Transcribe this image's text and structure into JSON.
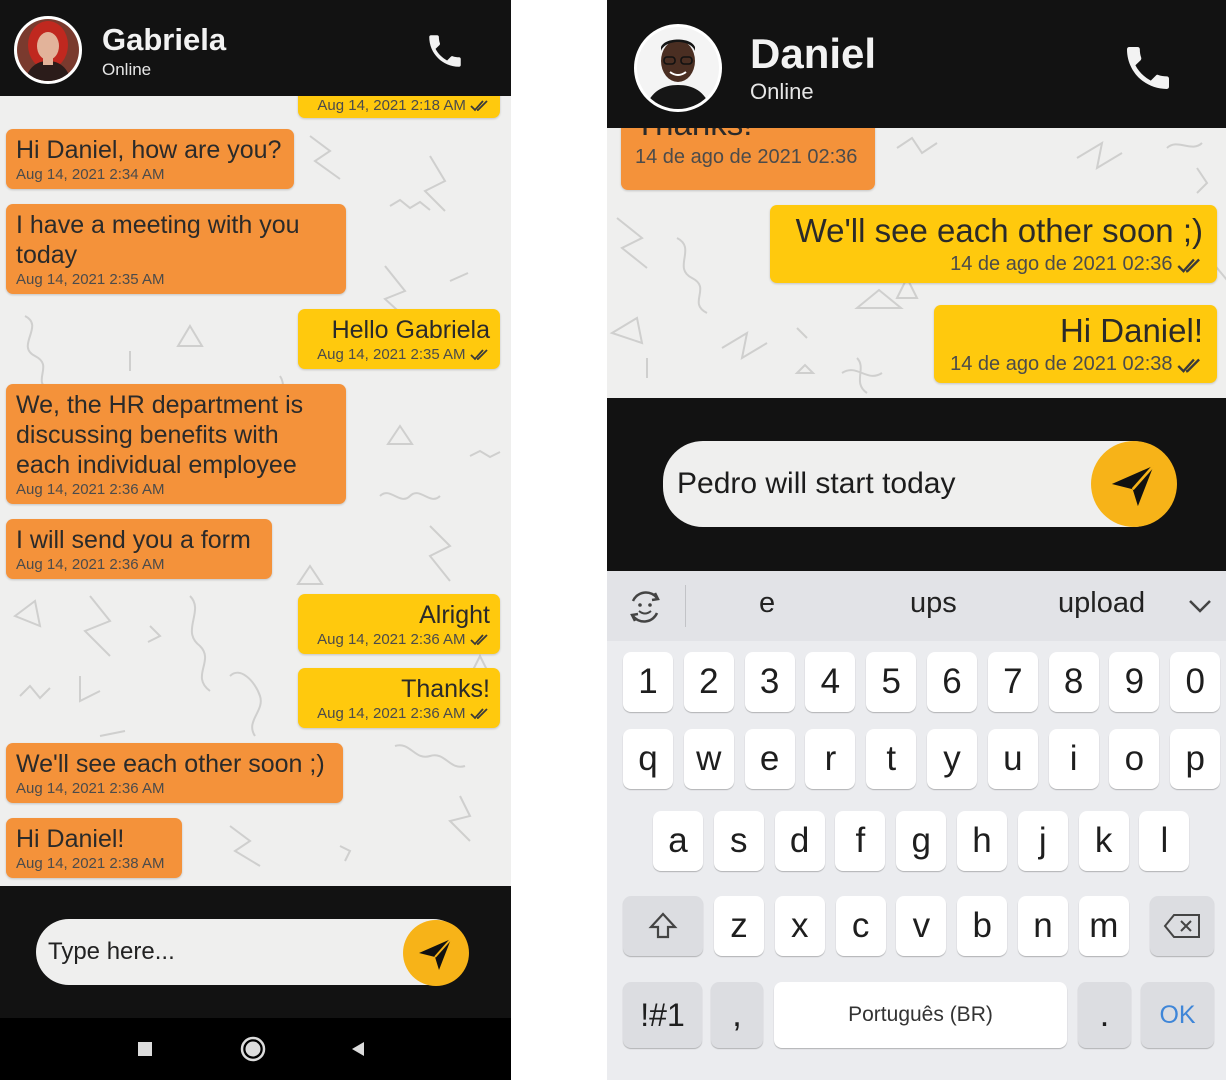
{
  "left_screen": {
    "contact": {
      "name": "Gabriela",
      "status": "Online"
    },
    "partial_top_time": "Aug 14, 2021 2:18 AM",
    "messages": [
      {
        "direction": "in",
        "text": "Hi Daniel, how are you?",
        "time": "Aug 14, 2021 2:34 AM"
      },
      {
        "direction": "in",
        "text": "I have a meeting with you\ntoday",
        "time": "Aug 14, 2021 2:35 AM"
      },
      {
        "direction": "out",
        "text": "Hello Gabriela",
        "time": "Aug 14, 2021 2:35 AM"
      },
      {
        "direction": "in",
        "text": "We, the HR department is\ndiscussing benefits with\neach individual  employee",
        "time": "Aug 14, 2021 2:36 AM"
      },
      {
        "direction": "in",
        "text": "I will send you a form",
        "time": "Aug 14, 2021 2:36 AM"
      },
      {
        "direction": "out",
        "text": "Alright",
        "time": "Aug 14, 2021 2:36 AM"
      },
      {
        "direction": "out",
        "text": "Thanks!",
        "time": "Aug 14, 2021 2:36 AM"
      },
      {
        "direction": "in",
        "text": "We'll see each other soon ;)",
        "time": "Aug 14, 2021 2:36 AM"
      },
      {
        "direction": "in",
        "text": "Hi Daniel!",
        "time": "Aug 14, 2021 2:38 AM"
      }
    ],
    "input": {
      "value": "",
      "placeholder": "Type here..."
    }
  },
  "right_screen": {
    "contact": {
      "name": "Daniel",
      "status": "Online"
    },
    "messages": [
      {
        "direction": "in",
        "text": "Thanks!",
        "time": "14 de ago de 2021 02:36"
      },
      {
        "direction": "out",
        "text": "We'll see each other soon ;)",
        "time": "14 de ago de 2021 02:36"
      },
      {
        "direction": "out",
        "text": "Hi Daniel!",
        "time": "14 de ago de 2021 02:38"
      }
    ],
    "input": {
      "value": "Pedro will start today",
      "placeholder": ""
    },
    "keyboard": {
      "suggestions": [
        "e",
        "ups",
        "upload"
      ],
      "row_numbers": [
        "1",
        "2",
        "3",
        "4",
        "5",
        "6",
        "7",
        "8",
        "9",
        "0"
      ],
      "row_1": [
        "q",
        "w",
        "e",
        "r",
        "t",
        "y",
        "u",
        "i",
        "o",
        "p"
      ],
      "row_2": [
        "a",
        "s",
        "d",
        "f",
        "g",
        "h",
        "j",
        "k",
        "l"
      ],
      "row_3": [
        "z",
        "x",
        "c",
        "v",
        "b",
        "n",
        "m"
      ],
      "symbols_label": "!#1",
      "comma_label": ",",
      "space_label": "Português (BR)",
      "period_label": ".",
      "ok_label": "OK"
    }
  },
  "colors": {
    "header": "#121212",
    "incoming_bubble": "#f4923a",
    "outgoing_bubble": "#ffc90d",
    "send_button": "#f7b318",
    "chat_background": "#efefee"
  },
  "icons": [
    "phone-icon",
    "send-icon",
    "double-check-icon",
    "emoji-sync-icon",
    "chevron-down-icon",
    "shift-icon",
    "backspace-icon",
    "nav-recents-icon",
    "nav-home-icon",
    "nav-back-icon"
  ]
}
